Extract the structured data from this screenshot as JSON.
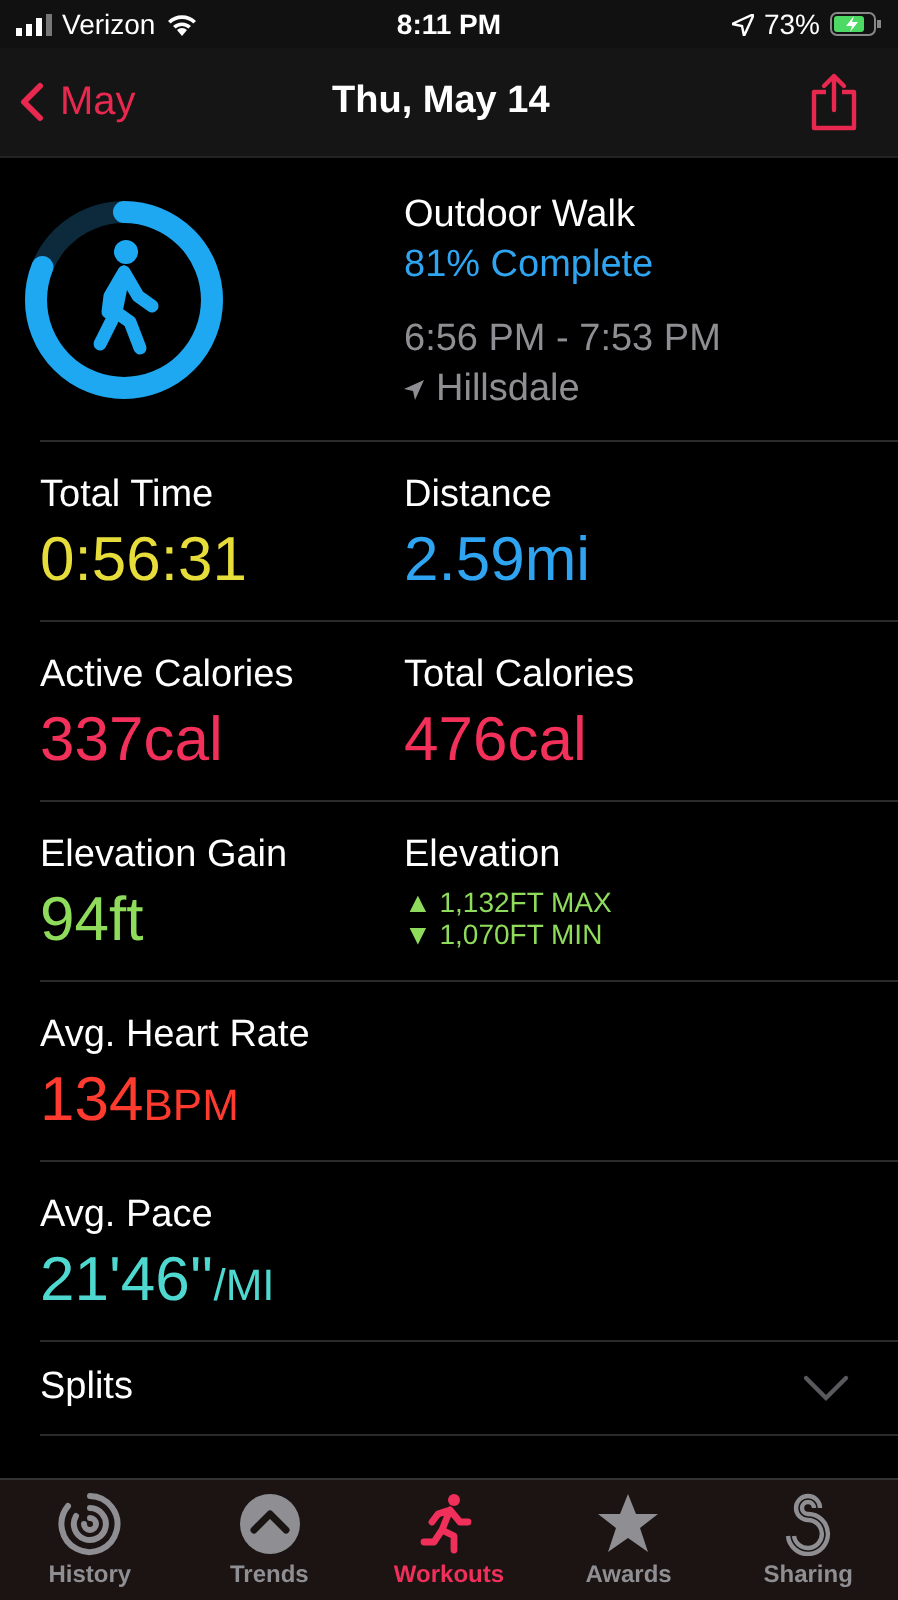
{
  "status_bar": {
    "carrier": "Verizon",
    "time": "8:11 PM",
    "battery": "73%"
  },
  "nav": {
    "back": "May",
    "title": "Thu, May 14"
  },
  "workout": {
    "name": "Outdoor Walk",
    "progress": "81% Complete",
    "level": 0.81,
    "time_range": "6:56 PM - 7:53 PM",
    "location": "Hillsdale"
  },
  "stats": [
    {
      "cells": [
        {
          "kind": "value",
          "label": "Total Time",
          "value": "0:56:31",
          "color": "#e6dc3a"
        },
        {
          "kind": "value",
          "label": "Distance",
          "value": "2.59mi",
          "color": "#2fa4f0"
        }
      ]
    },
    {
      "cells": [
        {
          "kind": "value",
          "label": "Active Calories",
          "value": "337cal",
          "color": "#f2305a"
        },
        {
          "kind": "value",
          "label": "Total Calories",
          "value": "476cal",
          "color": "#f2305a"
        }
      ]
    },
    {
      "cells": [
        {
          "kind": "value",
          "label": "Elevation Gain",
          "value": "94ft",
          "color": "#8fdc5c"
        },
        {
          "kind": "range",
          "label": "Elevation",
          "lines": [
            "▲ 1,132FT MAX",
            "▼ 1,070FT MIN"
          ],
          "color": "#8fdc5c"
        }
      ]
    },
    {
      "cells": [
        {
          "kind": "value",
          "label": "Avg. Heart Rate",
          "value": "134",
          "unit": "BPM",
          "color": "#ff3b2f"
        }
      ]
    },
    {
      "cells": [
        {
          "kind": "value",
          "label": "Avg. Pace",
          "value": "21'46''",
          "unit": "/MI",
          "color": "#4fd8cf"
        }
      ]
    }
  ],
  "sections": [
    {
      "label": "Splits",
      "expanded": false
    }
  ],
  "tabs": [
    {
      "kind": "history",
      "label": "History",
      "selected": false
    },
    {
      "kind": "trends",
      "label": "Trends",
      "selected": false
    },
    {
      "kind": "workouts",
      "label": "Workouts",
      "selected": true
    },
    {
      "kind": "awards",
      "label": "Awards",
      "selected": false
    },
    {
      "kind": "sharing",
      "label": "Sharing",
      "selected": false
    }
  ]
}
